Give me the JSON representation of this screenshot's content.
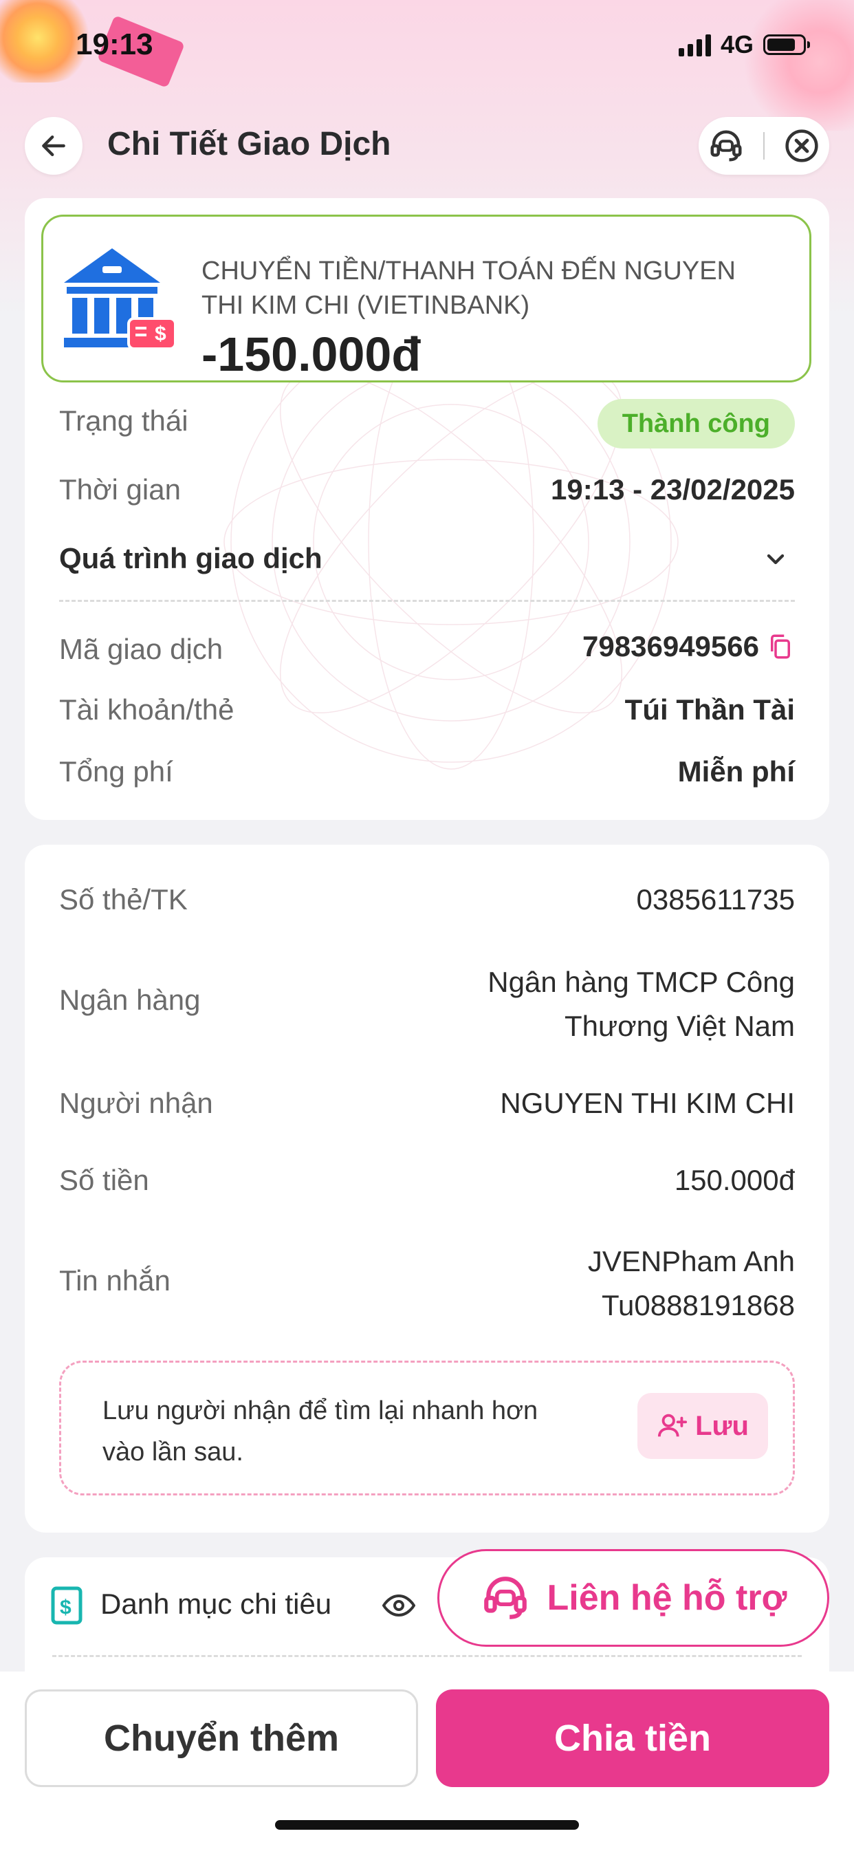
{
  "status_bar": {
    "time": "19:13",
    "network": "4G"
  },
  "header": {
    "title": "Chi Tiết Giao Dịch"
  },
  "summary": {
    "title": "CHUYỂN TIỀN/THANH TOÁN ĐẾN NGUYEN THI KIM CHI (VIETINBANK)",
    "amount": "-150.000đ"
  },
  "details": {
    "status_label": "Trạng thái",
    "status_value": "Thành công",
    "time_label": "Thời gian",
    "time_value": "19:13 - 23/02/2025",
    "process_label": "Quá trình giao dịch",
    "txn_id_label": "Mã giao dịch",
    "txn_id_value": "79836949566",
    "account_label": "Tài khoản/thẻ",
    "account_value": "Túi Thần Tài",
    "fee_label": "Tổng phí",
    "fee_value": "Miễn phí"
  },
  "recipient": {
    "card_label": "Số thẻ/TK",
    "card_value": "0385611735",
    "bank_label": "Ngân hàng",
    "bank_value_line1": "Ngân hàng TMCP Công",
    "bank_value_line2": "Thương Việt Nam",
    "name_label": "Người nhận",
    "name_value": "NGUYEN THI KIM CHI",
    "amount_label": "Số tiền",
    "amount_value": "150.000đ",
    "message_label": "Tin nhắn",
    "message_line1": "JVENPham Anh",
    "message_line2": "Tu0888191868",
    "save_prompt_line1": "Lưu người nhận để tìm lại nhanh hơn",
    "save_prompt_line2": "vào lần sau.",
    "save_button": "Lưu"
  },
  "category": {
    "label": "Danh mục chi tiêu"
  },
  "support": {
    "label": "Liên hệ hỗ trợ"
  },
  "actions": {
    "transfer_more": "Chuyển thêm",
    "split_bill": "Chia tiền"
  },
  "colors": {
    "brand": "#e8398d",
    "success_bg": "#d9f2c4",
    "success_text": "#4caf2a",
    "bank_blue": "#1f6fe0"
  },
  "icons": [
    "back-arrow-icon",
    "support-headset-icon",
    "close-icon",
    "bank-icon",
    "chevron-down-icon",
    "copy-icon",
    "add-user-icon",
    "money-note-icon",
    "eye-icon"
  ]
}
